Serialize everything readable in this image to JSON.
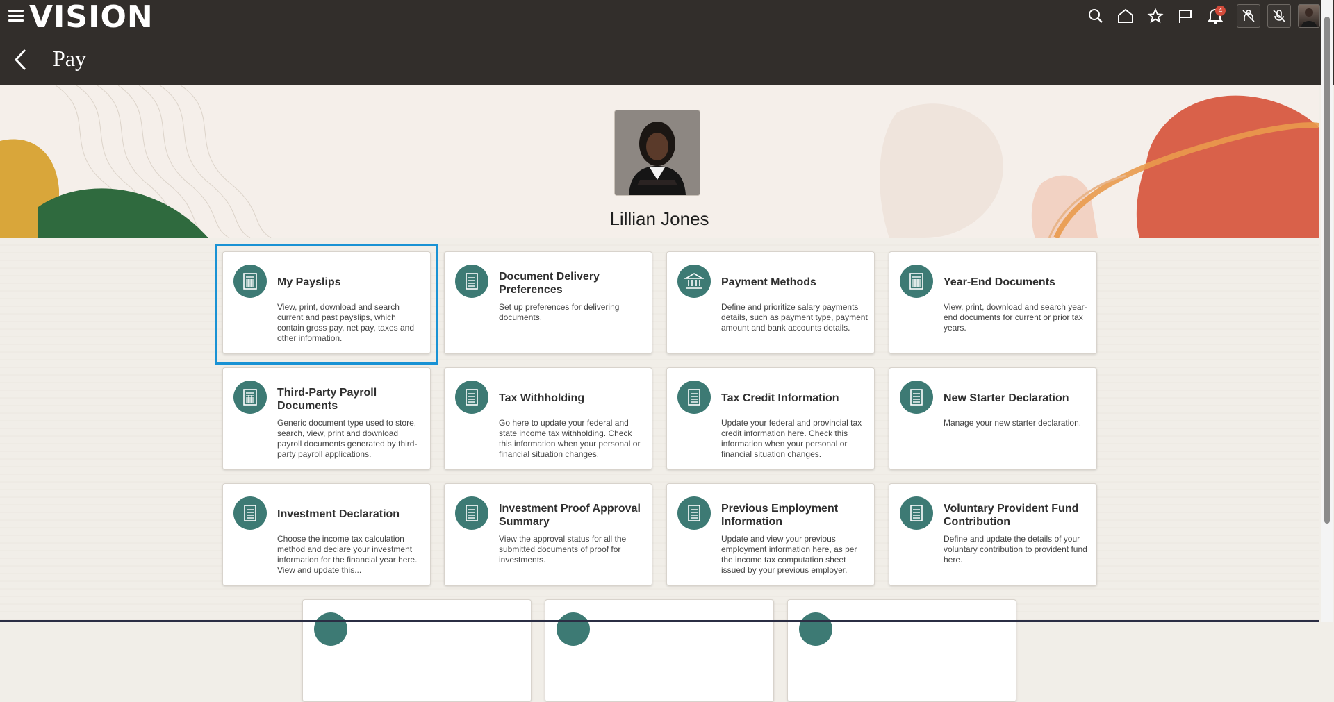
{
  "header": {
    "logo": "VISION",
    "page_title": "Pay",
    "notifications_count": "4",
    "icons": [
      "menu-icon",
      "search-icon",
      "home-icon",
      "star-icon",
      "flag-icon",
      "bell-icon",
      "accessibility-off-icon",
      "voice-off-icon",
      "user-avatar"
    ]
  },
  "profile": {
    "name": "Lillian Jones"
  },
  "cards": [
    {
      "title": "My Payslips",
      "desc": "View, print, download and search current and past payslips, which contain gross pay, net pay, taxes and other information.",
      "icon": "payslip-icon"
    },
    {
      "title": "Document Delivery Preferences",
      "desc": "Set up preferences for delivering documents.",
      "icon": "document-icon"
    },
    {
      "title": "Payment Methods",
      "desc": "Define and prioritize salary payments details, such as payment type, payment amount and bank accounts details.",
      "icon": "bank-icon"
    },
    {
      "title": "Year-End Documents",
      "desc": "View, print, download and search year-end documents for current or prior tax years.",
      "icon": "payslip-icon"
    },
    {
      "title": "Third-Party Payroll Documents",
      "desc": "Generic document type used to store, search, view, print and download payroll documents generated by third-party payroll applications.",
      "icon": "payslip-icon"
    },
    {
      "title": "Tax Withholding",
      "desc": "Go here to update your federal and state income tax withholding. Check this information when your personal or financial situation changes.",
      "icon": "document-icon"
    },
    {
      "title": "Tax Credit Information",
      "desc": "Update your federal and provincial tax credit information here. Check this information when your personal or financial situation changes.",
      "icon": "document-icon"
    },
    {
      "title": "New Starter Declaration",
      "desc": "Manage your new starter declaration.",
      "icon": "document-icon"
    },
    {
      "title": "Investment Declaration",
      "desc": "Choose the income tax calculation method and declare your investment information for the financial year here. View and update this...",
      "icon": "document-icon"
    },
    {
      "title": "Investment Proof Approval Summary",
      "desc": "View the approval status for all the submitted documents of proof for investments.",
      "icon": "document-icon"
    },
    {
      "title": "Previous Employment Information",
      "desc": "Update and view your previous employment information here, as per the income tax computation sheet issued by your previous employer.",
      "icon": "document-icon"
    },
    {
      "title": "Voluntary Provident Fund Contribution",
      "desc": "Define and update the details of your voluntary contribution to provident fund here.",
      "icon": "document-icon"
    }
  ],
  "colors": {
    "header_bg": "#322e2b",
    "icon_circle": "#3d7a74",
    "focus_border": "#1992d4",
    "badge": "#d24b3b"
  }
}
